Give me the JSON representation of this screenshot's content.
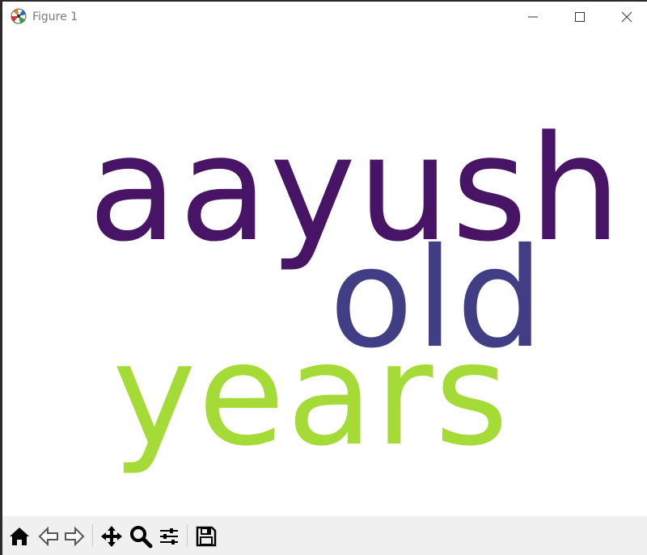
{
  "window": {
    "title": "Figure 1",
    "app_icon": "matplotlib-icon",
    "controls": [
      "minimize-icon",
      "maximize-icon",
      "close-icon"
    ]
  },
  "wordcloud": {
    "background": "#ffffff",
    "words": [
      {
        "text": "aayush",
        "color": "#471466"
      },
      {
        "text": "old",
        "color": "#413e85"
      },
      {
        "text": "years",
        "color": "#a5db36"
      }
    ]
  },
  "toolbar": {
    "background": "#f0f0f0",
    "tools": [
      "home-icon",
      "back-icon",
      "forward-icon",
      "pan-icon",
      "zoom-icon",
      "configure-subplots-icon",
      "save-icon"
    ]
  }
}
